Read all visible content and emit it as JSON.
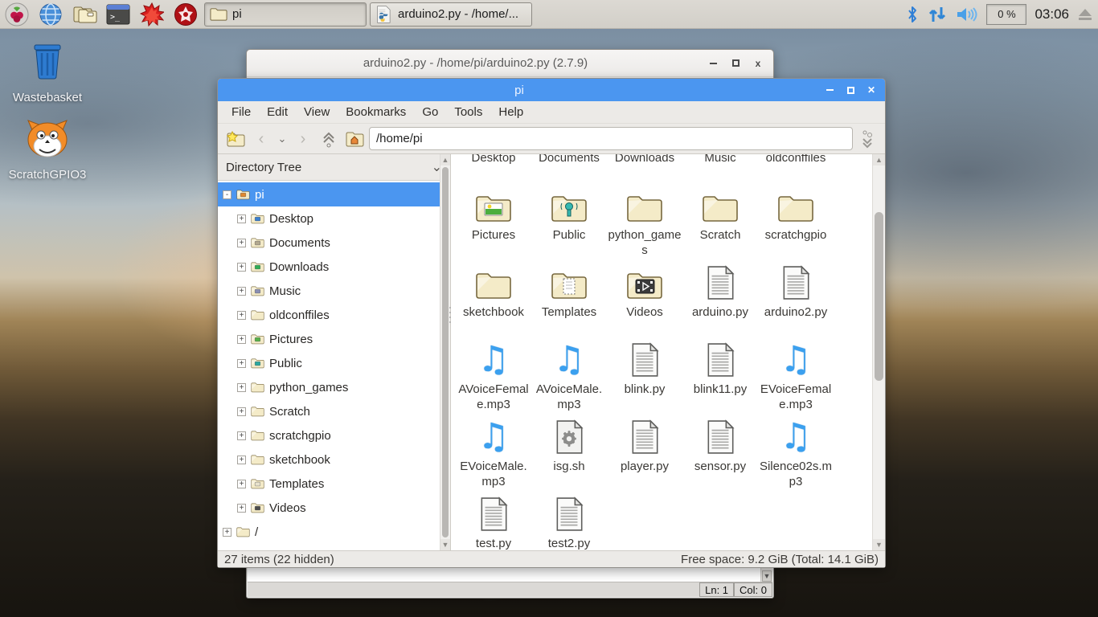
{
  "taskbar": {
    "launchers": [
      {
        "name": "raspberry-menu"
      },
      {
        "name": "web-browser"
      },
      {
        "name": "file-manager"
      },
      {
        "name": "terminal"
      },
      {
        "name": "mathematica"
      },
      {
        "name": "wolfram"
      }
    ],
    "windows": [
      {
        "label": "pi",
        "icon": "folder",
        "active": true
      },
      {
        "label": "arduino2.py - /home/...",
        "icon": "python-file",
        "active": false
      }
    ],
    "tray": {
      "icons": [
        "bluetooth-icon",
        "network-arrows-icon",
        "volume-icon",
        "eject-icon"
      ],
      "cpu": "0 %",
      "clock": "03:06"
    }
  },
  "desktop": {
    "icons": [
      {
        "label": "Wastebasket",
        "icon": "wastebasket"
      },
      {
        "label": "ScratchGPIO3",
        "icon": "scratch-cat"
      }
    ]
  },
  "idle_window": {
    "title": "arduino2.py - /home/pi/arduino2.py (2.7.9)",
    "status_ln": "Ln: 1",
    "status_col": "Col: 0"
  },
  "file_manager": {
    "title": "pi",
    "menu": [
      "File",
      "Edit",
      "View",
      "Bookmarks",
      "Go",
      "Tools",
      "Help"
    ],
    "path": "/home/pi",
    "sidebar": {
      "header": "Directory Tree",
      "items": [
        {
          "label": "pi",
          "depth": 0,
          "expander": "-",
          "icon": "home",
          "selected": true
        },
        {
          "label": "Desktop",
          "depth": 1,
          "expander": "+",
          "icon": "desktop"
        },
        {
          "label": "Documents",
          "depth": 1,
          "expander": "+",
          "icon": "documents"
        },
        {
          "label": "Downloads",
          "depth": 1,
          "expander": "+",
          "icon": "downloads"
        },
        {
          "label": "Music",
          "depth": 1,
          "expander": "+",
          "icon": "music"
        },
        {
          "label": "oldconffiles",
          "depth": 1,
          "expander": "+",
          "icon": "plain"
        },
        {
          "label": "Pictures",
          "depth": 1,
          "expander": "+",
          "icon": "pictures"
        },
        {
          "label": "Public",
          "depth": 1,
          "expander": "+",
          "icon": "public"
        },
        {
          "label": "python_games",
          "depth": 1,
          "expander": "+",
          "icon": "plain"
        },
        {
          "label": "Scratch",
          "depth": 1,
          "expander": "+",
          "icon": "plain"
        },
        {
          "label": "scratchgpio",
          "depth": 1,
          "expander": "+",
          "icon": "plain"
        },
        {
          "label": "sketchbook",
          "depth": 1,
          "expander": "+",
          "icon": "plain"
        },
        {
          "label": "Templates",
          "depth": 1,
          "expander": "+",
          "icon": "templates"
        },
        {
          "label": "Videos",
          "depth": 1,
          "expander": "+",
          "icon": "videos"
        },
        {
          "label": "/",
          "depth": 0,
          "expander": "+",
          "icon": "plain"
        }
      ]
    },
    "files": [
      {
        "name": "Desktop",
        "type": "folder"
      },
      {
        "name": "Documents",
        "type": "folder"
      },
      {
        "name": "Downloads",
        "type": "folder"
      },
      {
        "name": "Music",
        "type": "folder"
      },
      {
        "name": "oldconffiles",
        "type": "folder"
      },
      {
        "name": "Pictures",
        "type": "folder-image"
      },
      {
        "name": "Public",
        "type": "folder-public"
      },
      {
        "name": "python_games",
        "type": "folder"
      },
      {
        "name": "Scratch",
        "type": "folder"
      },
      {
        "name": "scratchgpio",
        "type": "folder"
      },
      {
        "name": "sketchbook",
        "type": "folder"
      },
      {
        "name": "Templates",
        "type": "folder-templates"
      },
      {
        "name": "Videos",
        "type": "folder-video"
      },
      {
        "name": "arduino.py",
        "type": "text-file"
      },
      {
        "name": "arduino2.py",
        "type": "text-file"
      },
      {
        "name": "AVoiceFemale.mp3",
        "type": "audio"
      },
      {
        "name": "AVoiceMale.mp3",
        "type": "audio"
      },
      {
        "name": "blink.py",
        "type": "text-file"
      },
      {
        "name": "blink11.py",
        "type": "text-file"
      },
      {
        "name": "EVoiceFemale.mp3",
        "type": "audio"
      },
      {
        "name": "EVoiceMale.mp3",
        "type": "audio"
      },
      {
        "name": "isg.sh",
        "type": "script"
      },
      {
        "name": "player.py",
        "type": "text-file"
      },
      {
        "name": "sensor.py",
        "type": "text-file"
      },
      {
        "name": "Silence02s.mp3",
        "type": "audio"
      },
      {
        "name": "test.py",
        "type": "text-file"
      },
      {
        "name": "test2.py",
        "type": "text-file"
      }
    ],
    "status_left": "27 items (22 hidden)",
    "status_right": "Free space: 9.2 GiB (Total: 14.1 GiB)"
  },
  "colors": {
    "titlebar_active": "#4b96f0",
    "selection": "#4b96f0",
    "folder_fill": "#f4ebc8",
    "audio_icon": "#3ba0ef",
    "taskbar_bg": "#d5d2cb"
  }
}
